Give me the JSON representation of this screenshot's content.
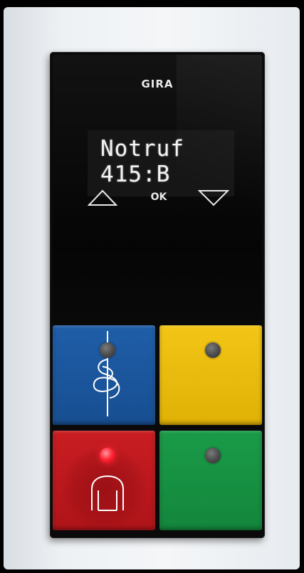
{
  "device": {
    "brand": "GIRA",
    "display": {
      "line1": "Notruf",
      "line2": "415:B"
    },
    "nav": {
      "ok_label": "OK"
    },
    "keys": {
      "blue": {
        "color": "#1f5ea8",
        "icon": "caduceus-icon",
        "led": "off"
      },
      "yellow": {
        "color": "#f2c516",
        "led": "off"
      },
      "red": {
        "color": "#c91d22",
        "icon": "person-icon",
        "led": "on"
      },
      "green": {
        "color": "#1a9b48",
        "led": "off"
      }
    }
  }
}
